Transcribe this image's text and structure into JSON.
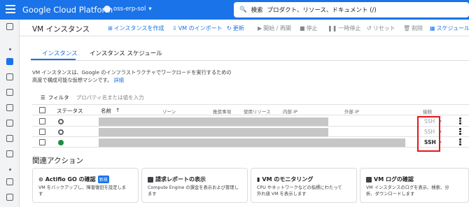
{
  "topbar": {
    "brand": "Google Cloud Platform",
    "project": "oss-erp-sol",
    "search_label": "検索",
    "search_placeholder": "プロダクト、リソース、ドキュメント (/)"
  },
  "toolbar": {
    "title": "VM インスタンス",
    "create": "インスタンスを作成",
    "import": "VM のインポート",
    "refresh": "更新",
    "start": "開始 / 再開",
    "stop": "停止",
    "suspend": "一時停止",
    "reset": "リセット",
    "delete": "削除",
    "schedule": "スケジュール"
  },
  "tabs": [
    "インスタンス",
    "インスタンス スケジュール"
  ],
  "description": {
    "line1": "VM インスタンスは、Google のインフラストラクチャでワークロードを実行するための",
    "line2": "高度で構成可能な仮想マシンです。",
    "link": "詳細"
  },
  "filter": {
    "label": "フィルタ",
    "placeholder": "プロパティ名または値を入力"
  },
  "table": {
    "columns": {
      "status": "ステータス",
      "name": "名前",
      "zone": "ゾーン",
      "recommendation": "推奨事項",
      "in_use": "使用リソース",
      "internal_ip": "内部 IP",
      "external_ip": "外部 IP",
      "connect": "接続"
    },
    "rows": [
      {
        "status": "stopped",
        "connect": "SSH"
      },
      {
        "status": "stopped",
        "connect": "SSH"
      },
      {
        "status": "running",
        "connect": "SSH"
      }
    ]
  },
  "related": {
    "title": "関連アクション",
    "cards": [
      {
        "title": "Actifio GO の確認",
        "badge": "新規",
        "desc1": "VM をバックアップし、障害復旧を設定しま",
        "desc2": "す"
      },
      {
        "title": "請求レポートの表示",
        "badge": "",
        "desc1": "Compute Engine の課金を表示および管理し",
        "desc2": "ます"
      },
      {
        "title": "VM のモニタリング",
        "badge": "",
        "desc1": "CPU やネットワークなどの指標にわたって",
        "desc2": "外れ値 VM を表示します"
      },
      {
        "title": "VM ログの確認",
        "badge": "",
        "desc1": "VM インスタンスのログを表示、検索、分",
        "desc2": "析、ダウンロードします"
      }
    ]
  },
  "colors": {
    "brand_blue": "#1a73e8",
    "running_green": "#1e8e3e",
    "highlight_red": "#e5161a"
  }
}
